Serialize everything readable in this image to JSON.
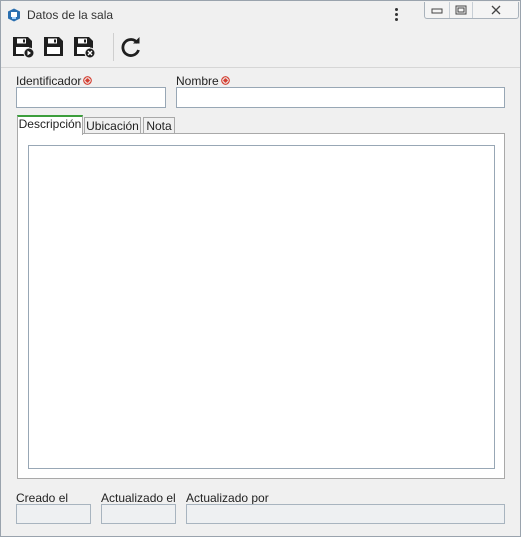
{
  "window": {
    "title": "Datos de la sala"
  },
  "form": {
    "identificador_label": "Identificador",
    "identificador_value": "",
    "nombre_label": "Nombre",
    "nombre_value": ""
  },
  "tabs": [
    {
      "label": "Descripción",
      "active": true
    },
    {
      "label": "Ubicación",
      "active": false
    },
    {
      "label": "Nota",
      "active": false
    }
  ],
  "descripcion": {
    "value": ""
  },
  "footer": {
    "creado_label": "Creado el",
    "creado_value": "",
    "actualizado_el_label": "Actualizado el",
    "actualizado_el_value": "",
    "actualizado_por_label": "Actualizado por",
    "actualizado_por_value": ""
  },
  "colors": {
    "active_tab_accent": "#3c9e3c",
    "required_marker": "#d33a2c",
    "app_icon": "#2a6fb0"
  },
  "icons": {
    "app": "app-icon",
    "menu": "kebab-menu-icon",
    "save_new": "save-and-new-icon",
    "save": "save-icon",
    "save_close": "save-and-close-icon",
    "refresh": "refresh-icon"
  }
}
